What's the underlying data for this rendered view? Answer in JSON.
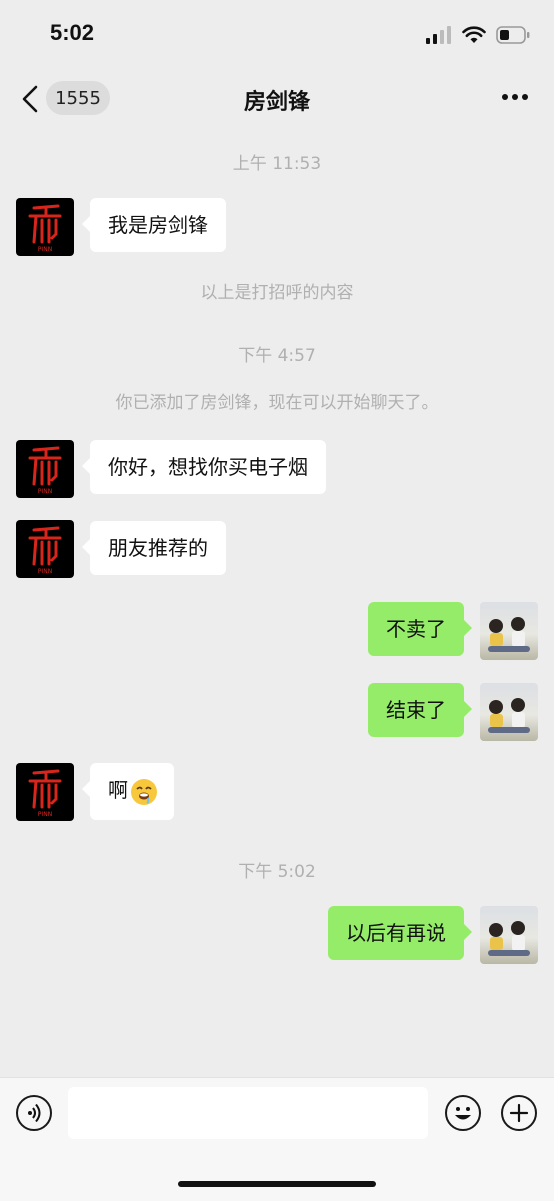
{
  "status_bar": {
    "time": "5:02"
  },
  "nav": {
    "unread_count": "1555",
    "title": "房剑锋"
  },
  "chat": {
    "timestamp_1": "上午 11:53",
    "msg_1": "我是房剑锋",
    "greeting_note": "以上是打招呼的内容",
    "timestamp_2": "下午 4:57",
    "added_notice": "你已添加了房剑锋，现在可以开始聊天了。",
    "msg_2": "你好，想找你买电子烟",
    "msg_3": "朋友推荐的",
    "msg_4": "不卖了",
    "msg_5": "结束了",
    "msg_6": "啊",
    "timestamp_3": "下午 5:02",
    "msg_7": "以后有再说"
  },
  "contact_avatar_text": "PINN",
  "icons": {
    "back": "chevron-left-icon",
    "more": "more-dots-icon",
    "voice": "voice-icon",
    "emoji": "smiley-icon",
    "add": "plus-icon"
  },
  "colors": {
    "background": "#ededed",
    "sent_bubble": "#95ec69",
    "received_bubble": "#ffffff",
    "avatar_red": "#d9261c"
  }
}
